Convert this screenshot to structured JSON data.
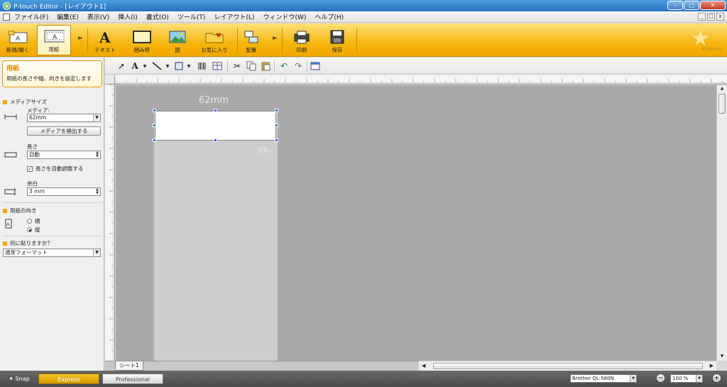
{
  "window": {
    "title": "P-touch Editor - [レイアウト1]"
  },
  "menubar": {
    "items": [
      "ファイル(F)",
      "編集(E)",
      "表示(V)",
      "挿入(I)",
      "書式(O)",
      "ツール(T)",
      "レイアウト(L)",
      "ウィンドウ(W)",
      "ヘルプ(H)"
    ]
  },
  "ribbon": {
    "buttons": [
      {
        "label": "新規/開く",
        "icon": "new-open-icon"
      },
      {
        "label": "用紙",
        "icon": "paper-icon",
        "active": true
      },
      {
        "label": "テキスト",
        "icon": "text-icon"
      },
      {
        "label": "囲み枠",
        "icon": "frame-icon"
      },
      {
        "label": "図",
        "icon": "image-icon"
      },
      {
        "label": "お気に入り",
        "icon": "favorites-icon"
      },
      {
        "label": "配置",
        "icon": "arrange-icon"
      },
      {
        "label": "印刷",
        "icon": "print-icon"
      },
      {
        "label": "保存",
        "icon": "save-icon"
      }
    ],
    "logo_text": "Express"
  },
  "panel": {
    "help_title": "用紙",
    "help_desc": "用紙の長さや幅、向きを設定します",
    "media_size_heading": "メディアサイズ",
    "media_label": "メディア:",
    "media_value": "62mm",
    "detect_button": "メディアを検出する",
    "length_label": "長さ",
    "length_value": "自動",
    "auto_length_checkbox": "長さを自動調整する",
    "auto_length_checked": true,
    "margin_label": "余白",
    "margin_value": "3 mm",
    "orientation_heading": "用紙の向き",
    "orientation_landscape": "横",
    "orientation_portrait": "縦",
    "orientation_selected": "portrait",
    "stick_heading": "何に貼りますか？",
    "stick_value": "通常フォーマット"
  },
  "canvas": {
    "paper_width_label": "62mm",
    "paper_length_label": "自動",
    "background_color": "#a9a9a9",
    "paper_color": "#cdcdcd",
    "handle_color": "#1a6fe0"
  },
  "sheet": {
    "tab_label": "シート1"
  },
  "statusbar": {
    "snap_label": "Snap",
    "express_label": "Express",
    "professional_label": "Professional",
    "printer_value": "Brother QL-580N",
    "zoom_value": "100 %"
  }
}
